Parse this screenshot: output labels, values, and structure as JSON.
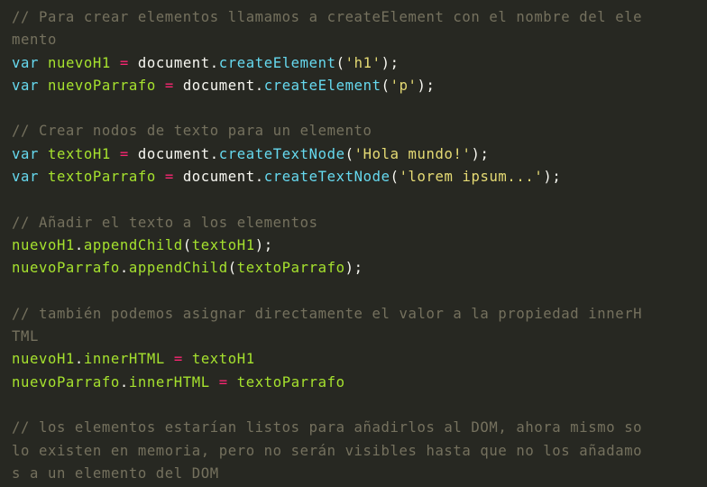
{
  "code": {
    "language": "javascript",
    "lines": [
      [
        {
          "t": "comment",
          "v": "// Para crear elementos llamamos a createElement con el nombre del ele"
        }
      ],
      [
        {
          "t": "comment",
          "v": "mento"
        }
      ],
      [
        {
          "t": "keyword",
          "v": "var"
        },
        {
          "t": "plain",
          "v": " "
        },
        {
          "t": "var",
          "v": "nuevoH1"
        },
        {
          "t": "plain",
          "v": " "
        },
        {
          "t": "op",
          "v": "="
        },
        {
          "t": "plain",
          "v": " document."
        },
        {
          "t": "method",
          "v": "createElement"
        },
        {
          "t": "plain",
          "v": "("
        },
        {
          "t": "string",
          "v": "'h1'"
        },
        {
          "t": "plain",
          "v": ");"
        }
      ],
      [
        {
          "t": "keyword",
          "v": "var"
        },
        {
          "t": "plain",
          "v": " "
        },
        {
          "t": "var",
          "v": "nuevoParrafo"
        },
        {
          "t": "plain",
          "v": " "
        },
        {
          "t": "op",
          "v": "="
        },
        {
          "t": "plain",
          "v": " document."
        },
        {
          "t": "method",
          "v": "createElement"
        },
        {
          "t": "plain",
          "v": "("
        },
        {
          "t": "string",
          "v": "'p'"
        },
        {
          "t": "plain",
          "v": ");"
        }
      ],
      [],
      [
        {
          "t": "comment",
          "v": "// Crear nodos de texto para un elemento"
        }
      ],
      [
        {
          "t": "keyword",
          "v": "var"
        },
        {
          "t": "plain",
          "v": " "
        },
        {
          "t": "var",
          "v": "textoH1"
        },
        {
          "t": "plain",
          "v": " "
        },
        {
          "t": "op",
          "v": "="
        },
        {
          "t": "plain",
          "v": " document."
        },
        {
          "t": "method",
          "v": "createTextNode"
        },
        {
          "t": "plain",
          "v": "("
        },
        {
          "t": "string",
          "v": "'Hola mundo!'"
        },
        {
          "t": "plain",
          "v": ");"
        }
      ],
      [
        {
          "t": "keyword",
          "v": "var"
        },
        {
          "t": "plain",
          "v": " "
        },
        {
          "t": "var",
          "v": "textoParrafo"
        },
        {
          "t": "plain",
          "v": " "
        },
        {
          "t": "op",
          "v": "="
        },
        {
          "t": "plain",
          "v": " document."
        },
        {
          "t": "method",
          "v": "createTextNode"
        },
        {
          "t": "plain",
          "v": "("
        },
        {
          "t": "string",
          "v": "'lorem ipsum...'"
        },
        {
          "t": "plain",
          "v": ");"
        }
      ],
      [],
      [
        {
          "t": "comment",
          "v": "// Añadir el texto a los elementos"
        }
      ],
      [
        {
          "t": "var",
          "v": "nuevoH1"
        },
        {
          "t": "plain",
          "v": "."
        },
        {
          "t": "var",
          "v": "appendChild"
        },
        {
          "t": "plain",
          "v": "("
        },
        {
          "t": "var",
          "v": "textoH1"
        },
        {
          "t": "plain",
          "v": ");"
        }
      ],
      [
        {
          "t": "var",
          "v": "nuevoParrafo"
        },
        {
          "t": "plain",
          "v": "."
        },
        {
          "t": "var",
          "v": "appendChild"
        },
        {
          "t": "plain",
          "v": "("
        },
        {
          "t": "var",
          "v": "textoParrafo"
        },
        {
          "t": "plain",
          "v": ");"
        }
      ],
      [],
      [
        {
          "t": "comment",
          "v": "// también podemos asignar directamente el valor a la propiedad innerH"
        }
      ],
      [
        {
          "t": "comment",
          "v": "TML"
        }
      ],
      [
        {
          "t": "var",
          "v": "nuevoH1"
        },
        {
          "t": "plain",
          "v": "."
        },
        {
          "t": "var",
          "v": "innerHTML"
        },
        {
          "t": "plain",
          "v": " "
        },
        {
          "t": "op",
          "v": "="
        },
        {
          "t": "plain",
          "v": " "
        },
        {
          "t": "var",
          "v": "textoH1"
        }
      ],
      [
        {
          "t": "var",
          "v": "nuevoParrafo"
        },
        {
          "t": "plain",
          "v": "."
        },
        {
          "t": "var",
          "v": "innerHTML"
        },
        {
          "t": "plain",
          "v": " "
        },
        {
          "t": "op",
          "v": "="
        },
        {
          "t": "plain",
          "v": " "
        },
        {
          "t": "var",
          "v": "textoParrafo"
        }
      ],
      [],
      [
        {
          "t": "comment",
          "v": "// los elementos estarían listos para añadirlos al DOM, ahora mismo so"
        }
      ],
      [
        {
          "t": "comment",
          "v": "lo existen en memoria, pero no serán visibles hasta que no los añadamo"
        }
      ],
      [
        {
          "t": "comment",
          "v": "s a un elemento del DOM"
        }
      ]
    ]
  },
  "colors": {
    "background": "#272822",
    "comment": "#75715e",
    "keyword": "#66d9ef",
    "variable": "#a6e22e",
    "operator": "#f92672",
    "plain": "#f8f8f2",
    "string": "#e6db74"
  }
}
